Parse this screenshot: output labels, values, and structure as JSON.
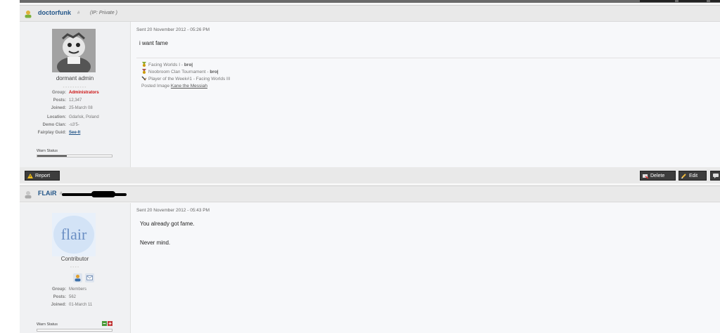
{
  "posts": [
    {
      "username": "doctorfunk",
      "ip": "(IP: Private )",
      "rank_title": "dormant admin",
      "fields": [
        {
          "label": "Group:",
          "value": "Administrators"
        },
        {
          "label": "Posts:",
          "value": "12,347"
        },
        {
          "label": "Joined:",
          "value": "25-March 08"
        },
        {
          "label": "Location:",
          "value": "Gdańsk, Poland"
        },
        {
          "label": "Demo Clan:",
          "value": "-s3'5-"
        },
        {
          "label": "Fairplay Guid:",
          "value": "See-It"
        }
      ],
      "warn_status_label": "Warn Status",
      "warn_level_fraction": 0.4,
      "date": "Sent 20 November 2012 - 05:26 PM",
      "body": [
        "i want fame"
      ],
      "signature": {
        "lines": [
          {
            "text": "Facing Worlds I - ",
            "bold": "bro|"
          },
          {
            "text": "Noobroom Clan Tournament - ",
            "bold": "bro|"
          },
          {
            "text": "Player of the Week#1 - Facing Worlds III",
            "bold": ""
          }
        ],
        "posted_image_text": "Posted Image",
        "posted_image_link": "Kane the Messiah"
      }
    },
    {
      "username": "FLAiR",
      "rank_title": "Contributor",
      "avatar_text": "flair",
      "fields": [
        {
          "label": "Group:",
          "value": "Members"
        },
        {
          "label": "Posts:",
          "value": "562"
        },
        {
          "label": "Joined:",
          "value": "01-March 11"
        }
      ],
      "warn_status_label": "Warn Status",
      "date": "Sent 20 November 2012 - 05:43 PM",
      "body": [
        "You already got fame.",
        "Never mind."
      ]
    }
  ],
  "toolbar": {
    "report_label": "Report",
    "delete_label": "Delete",
    "edit_label": "Edit"
  }
}
